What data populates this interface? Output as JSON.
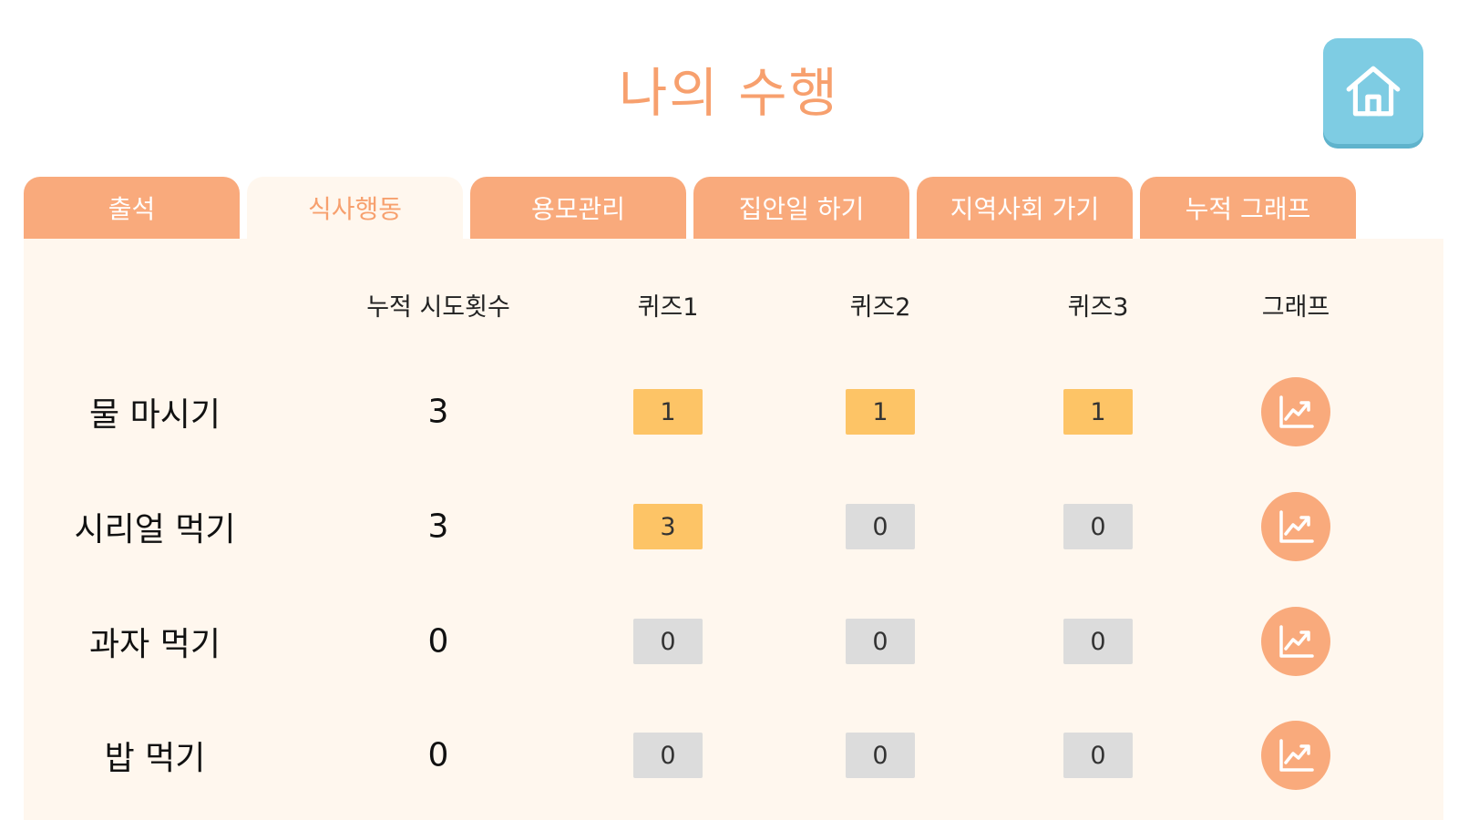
{
  "page": {
    "title": "나의 수행"
  },
  "home_button": {
    "icon": "home-icon"
  },
  "tabs": [
    {
      "label": "출석",
      "active": false
    },
    {
      "label": "식사행동",
      "active": true
    },
    {
      "label": "용모관리",
      "active": false
    },
    {
      "label": "집안일 하기",
      "active": false
    },
    {
      "label": "지역사회 가기",
      "active": false
    },
    {
      "label": "누적 그래프",
      "active": false
    }
  ],
  "table": {
    "headers": [
      "누적 시도횟수",
      "퀴즈1",
      "퀴즈2",
      "퀴즈3",
      "그래프"
    ],
    "rows": [
      {
        "label": "물 마시기",
        "count": "3",
        "quiz": [
          "1",
          "1",
          "1"
        ]
      },
      {
        "label": "시리얼 먹기",
        "count": "3",
        "quiz": [
          "3",
          "0",
          "0"
        ]
      },
      {
        "label": "과자 먹기",
        "count": "0",
        "quiz": [
          "0",
          "0",
          "0"
        ]
      },
      {
        "label": "밥 먹기",
        "count": "0",
        "quiz": [
          "0",
          "0",
          "0"
        ]
      }
    ],
    "graph_icon": "chart-icon"
  },
  "colors": {
    "accent": "#f7a06e",
    "tab_bg": "#f9aa7c",
    "panel_bg": "#fff7ee",
    "home_button": "#7ecce3",
    "score_positive": "#fdc466",
    "score_zero": "#dcdcdc"
  }
}
